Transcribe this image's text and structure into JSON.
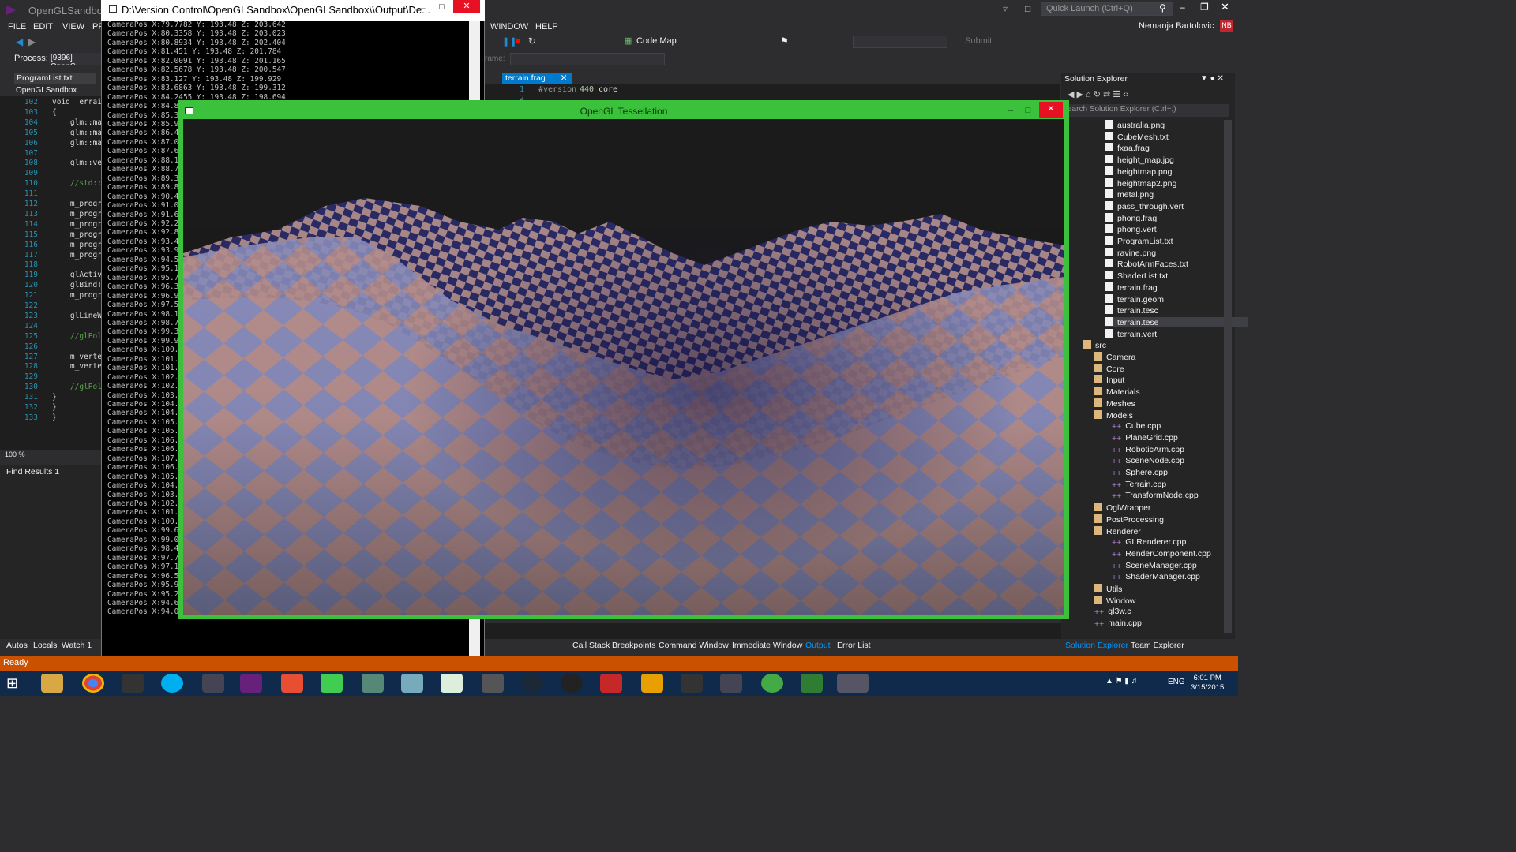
{
  "vs": {
    "title": "OpenGLSandbox",
    "menu": [
      "FILE",
      "EDIT",
      "VIEW",
      "PR",
      "WINDOW",
      "HELP"
    ],
    "quick_launch_placeholder": "Quick Launch (Ctrl+Q)",
    "user_name": "Nemanja Bartolovic",
    "user_initials": "NB",
    "process_label": "Process:",
    "process_value": "[9396] OpenGL",
    "code_map": "Code Map",
    "submit": "Submit",
    "frame_label": "rame:"
  },
  "left_editor": {
    "tab": "ProgramList.txt",
    "nav": "OpenGLSandbox",
    "lines": [
      {
        "n": "102",
        "code": "void Terrai"
      },
      {
        "n": "103",
        "code": "{"
      },
      {
        "n": "104",
        "code": "    glm::ma"
      },
      {
        "n": "105",
        "code": "    glm::ma"
      },
      {
        "n": "106",
        "code": "    glm::ma"
      },
      {
        "n": "107",
        "code": ""
      },
      {
        "n": "108",
        "code": "    glm::ve"
      },
      {
        "n": "109",
        "code": ""
      },
      {
        "n": "110",
        "code": "    //std::"
      },
      {
        "n": "111",
        "code": ""
      },
      {
        "n": "112",
        "code": "    m_progr"
      },
      {
        "n": "113",
        "code": "    m_progr"
      },
      {
        "n": "114",
        "code": "    m_progr"
      },
      {
        "n": "115",
        "code": "    m_progr"
      },
      {
        "n": "116",
        "code": "    m_progr"
      },
      {
        "n": "117",
        "code": "    m_progr"
      },
      {
        "n": "118",
        "code": ""
      },
      {
        "n": "119",
        "code": "    glActiv"
      },
      {
        "n": "120",
        "code": "    glBindT"
      },
      {
        "n": "121",
        "code": "    m_progr"
      },
      {
        "n": "122",
        "code": ""
      },
      {
        "n": "123",
        "code": "    glLineW"
      },
      {
        "n": "124",
        "code": ""
      },
      {
        "n": "125",
        "code": "    //glPol"
      },
      {
        "n": "126",
        "code": ""
      },
      {
        "n": "127",
        "code": "    m_verte"
      },
      {
        "n": "128",
        "code": "    m_verte"
      },
      {
        "n": "129",
        "code": ""
      },
      {
        "n": "130",
        "code": "    //glPol"
      },
      {
        "n": "131",
        "code": "}"
      },
      {
        "n": "132",
        "code": "}"
      },
      {
        "n": "133",
        "code": "}"
      }
    ],
    "zoom": "100 %",
    "find_results": "Find Results 1",
    "bottom_tabs": [
      "Autos",
      "Locals",
      "Watch 1"
    ]
  },
  "console": {
    "title": "D:\\Version Control\\OpenGLSandbox\\OpenGLSandbox\\\\Output\\De...",
    "lines": [
      "CameraPos X:79.7782 Y: 193.48 Z: 203.642",
      "CameraPos X:80.3358 Y: 193.48 Z: 203.023",
      "CameraPos X:80.8934 Y: 193.48 Z: 202.404",
      "CameraPos X:81.451 Y: 193.48 Z: 201.784",
      "CameraPos X:82.0091 Y: 193.48 Z: 201.165",
      "CameraPos X:82.5678 Y: 193.48 Z: 200.547",
      "CameraPos X:83.127 Y: 193.48 Z: 199.929",
      "CameraPos X:83.6863 Y: 193.48 Z: 199.312",
      "CameraPos X:84.2455 Y: 193.48 Z: 198.694",
      "CameraPos X:84.8",
      "CameraPos X:85.3",
      "CameraPos X:85.9",
      "CameraPos X:86.4",
      "CameraPos X:87.0",
      "CameraPos X:87.6",
      "CameraPos X:88.1",
      "CameraPos X:88.7",
      "CameraPos X:89.3",
      "CameraPos X:89.8",
      "CameraPos X:90.4",
      "CameraPos X:91.0",
      "CameraPos X:91.6",
      "CameraPos X:92.2",
      "CameraPos X:92.8",
      "CameraPos X:93.4",
      "CameraPos X:93.9",
      "CameraPos X:94.5",
      "CameraPos X:95.1",
      "CameraPos X:95.7",
      "CameraPos X:96.3",
      "CameraPos X:96.9",
      "CameraPos X:97.5",
      "CameraPos X:98.1",
      "CameraPos X:98.7",
      "CameraPos X:99.3",
      "CameraPos X:99.9",
      "CameraPos X:100.",
      "CameraPos X:101.",
      "CameraPos X:101.",
      "CameraPos X:102.",
      "CameraPos X:102.",
      "CameraPos X:103.",
      "CameraPos X:104.",
      "CameraPos X:104.",
      "CameraPos X:105.",
      "CameraPos X:105.",
      "CameraPos X:106.",
      "CameraPos X:106.",
      "CameraPos X:107.",
      "CameraPos X:106.",
      "CameraPos X:105.",
      "CameraPos X:104.",
      "CameraPos X:103.",
      "CameraPos X:102.",
      "CameraPos X:101.",
      "CameraPos X:100.",
      "CameraPos X:99.6",
      "CameraPos X:99.0",
      "CameraPos X:98.4",
      "CameraPos X:97.7",
      "CameraPos X:97.1",
      "CameraPos X:96.5575 Y: 193.48 Z: 185.047",
      "CameraPos X:95.9114 Y: 193.48 Z: 185.597",
      "CameraPos X:95.2848 Y: 193.48 Z: 186.146",
      "CameraPos X:94.6583 Y: 193.48 Z: 186.696",
      "CameraPos X:94.0318 Y: 193.48 Z: 187.245"
    ]
  },
  "right_editor": {
    "tab": "terrain.frag",
    "line1_n": "1",
    "line1_kw": "#version",
    "line1_num": "440",
    "line1_rest": "core",
    "line2_n": "2"
  },
  "gl_window": {
    "title": "OpenGL Tessellation"
  },
  "solution_explorer": {
    "title": "Solution Explorer",
    "search_placeholder": "earch Solution Explorer (Ctrl+;)",
    "items": [
      {
        "label": "australia.png",
        "indent": 2,
        "type": "file"
      },
      {
        "label": "CubeMesh.txt",
        "indent": 2,
        "type": "file"
      },
      {
        "label": "fxaa.frag",
        "indent": 2,
        "type": "file"
      },
      {
        "label": "height_map.jpg",
        "indent": 2,
        "type": "file"
      },
      {
        "label": "heightmap.png",
        "indent": 2,
        "type": "file"
      },
      {
        "label": "heightmap2.png",
        "indent": 2,
        "type": "file"
      },
      {
        "label": "metal.png",
        "indent": 2,
        "type": "file"
      },
      {
        "label": "pass_through.vert",
        "indent": 2,
        "type": "file"
      },
      {
        "label": "phong.frag",
        "indent": 2,
        "type": "file"
      },
      {
        "label": "phong.vert",
        "indent": 2,
        "type": "file"
      },
      {
        "label": "ProgramList.txt",
        "indent": 2,
        "type": "file"
      },
      {
        "label": "ravine.png",
        "indent": 2,
        "type": "file"
      },
      {
        "label": "RobotArmFaces.txt",
        "indent": 2,
        "type": "file"
      },
      {
        "label": "ShaderList.txt",
        "indent": 2,
        "type": "file"
      },
      {
        "label": "terrain.frag",
        "indent": 2,
        "type": "file"
      },
      {
        "label": "terrain.geom",
        "indent": 2,
        "type": "file"
      },
      {
        "label": "terrain.tesc",
        "indent": 2,
        "type": "file"
      },
      {
        "label": "terrain.tese",
        "indent": 2,
        "type": "file",
        "selected": true
      },
      {
        "label": "terrain.vert",
        "indent": 2,
        "type": "file"
      },
      {
        "label": "src",
        "indent": 0,
        "type": "folder",
        "expanded": true
      },
      {
        "label": "Camera",
        "indent": 1,
        "type": "folder"
      },
      {
        "label": "Core",
        "indent": 1,
        "type": "folder"
      },
      {
        "label": "Input",
        "indent": 1,
        "type": "folder"
      },
      {
        "label": "Materials",
        "indent": 1,
        "type": "folder"
      },
      {
        "label": "Meshes",
        "indent": 1,
        "type": "folder"
      },
      {
        "label": "Models",
        "indent": 1,
        "type": "folder",
        "expanded": true
      },
      {
        "label": "Cube.cpp",
        "indent": 2,
        "type": "cpp"
      },
      {
        "label": "PlaneGrid.cpp",
        "indent": 2,
        "type": "cpp"
      },
      {
        "label": "RoboticArm.cpp",
        "indent": 2,
        "type": "cpp"
      },
      {
        "label": "SceneNode.cpp",
        "indent": 2,
        "type": "cpp"
      },
      {
        "label": "Sphere.cpp",
        "indent": 2,
        "type": "cpp"
      },
      {
        "label": "Terrain.cpp",
        "indent": 2,
        "type": "cpp"
      },
      {
        "label": "TransformNode.cpp",
        "indent": 2,
        "type": "cpp"
      },
      {
        "label": "OglWrapper",
        "indent": 1,
        "type": "folder"
      },
      {
        "label": "PostProcessing",
        "indent": 1,
        "type": "folder"
      },
      {
        "label": "Renderer",
        "indent": 1,
        "type": "folder",
        "expanded": true
      },
      {
        "label": "GLRenderer.cpp",
        "indent": 2,
        "type": "cpp"
      },
      {
        "label": "RenderComponent.cpp",
        "indent": 2,
        "type": "cpp"
      },
      {
        "label": "SceneManager.cpp",
        "indent": 2,
        "type": "cpp"
      },
      {
        "label": "ShaderManager.cpp",
        "indent": 2,
        "type": "cpp"
      },
      {
        "label": "Utils",
        "indent": 1,
        "type": "folder"
      },
      {
        "label": "Window",
        "indent": 1,
        "type": "folder"
      },
      {
        "label": "gl3w.c",
        "indent": 1,
        "type": "cpp"
      },
      {
        "label": "main.cpp",
        "indent": 1,
        "type": "cpp"
      }
    ],
    "bottom_tabs": [
      "Solution Explorer",
      "Team Explorer"
    ]
  },
  "output_tabs": [
    "Call Stack",
    "Breakpoints",
    "Command Window",
    "Immediate Window",
    "Output",
    "Error List"
  ],
  "status": "Ready",
  "taskbar": {
    "time": "6:01 PM",
    "date": "3/15/2015",
    "lang": "ENG"
  },
  "colors": {
    "vs_bg": "#2d2d30",
    "accent": "#007acc",
    "status_orange": "#ca5100",
    "gl_border": "#3bc13b",
    "terrain_pink": "#b48c8c",
    "terrain_blue": "#8287b4"
  }
}
